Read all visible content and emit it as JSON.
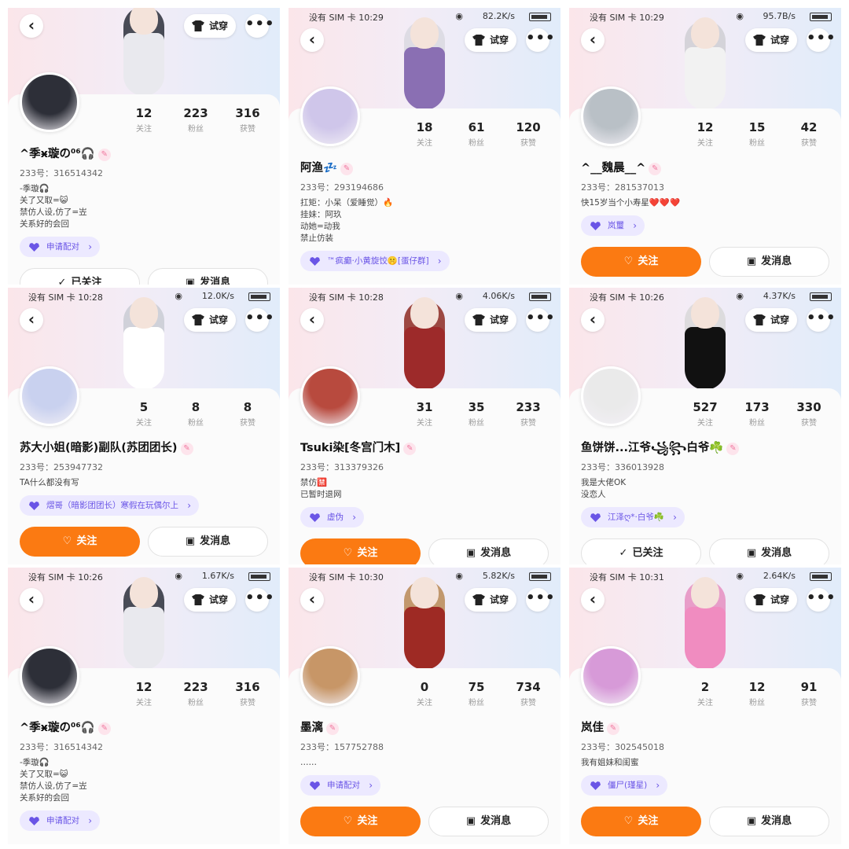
{
  "stat_labels": {
    "following": "关注",
    "fans": "粉丝",
    "likes": "获赞"
  },
  "buttons": {
    "try_on": "试穿",
    "follow": "关注",
    "followed": "已关注",
    "message": "发消息",
    "more": "•••",
    "back": "‹"
  },
  "icons": {
    "back": "chevron-left-icon",
    "try_on": "tshirt-icon",
    "more": "more-dots-icon",
    "tag": "heart-icon",
    "follow": "heart-plus-icon",
    "message": "chat-bubble-icon",
    "pin": "pin-badge-icon"
  },
  "colors": {
    "accent_orange": "#fb7a12",
    "tag_purple": "#6a55e6",
    "tag_bg": "#ece9ff"
  },
  "profiles": [
    {
      "status": {
        "time": "",
        "speed": "",
        "carrier": ""
      },
      "following": "12",
      "fans": "223",
      "likes": "316",
      "name": "^季ӿ璇の⁰⁶🎧",
      "uid": "233号：316514342",
      "bio": [
        "-季璇🎧",
        "关了又取=😺",
        "禁仿人设,仿了=岦",
        "关系好的会回"
      ],
      "tag": "申请配对",
      "follow_state": "followed"
    },
    {
      "status": {
        "time": "没有 SIM 卡 10:29",
        "speed": "82.2K/s"
      },
      "following": "18",
      "fans": "61",
      "likes": "120",
      "name": "阿渔💤",
      "uid": "233号：293194686",
      "bio": [
        "扛矩：小呆（爱睡觉）🔥",
        "挂妹：阿玖",
        "动她=动我",
        "禁止仿装"
      ],
      "tag": "™疯癫·小黄旋饺🤫[蛋仔群]",
      "follow_state": "none"
    },
    {
      "status": {
        "time": "没有 SIM 卡 10:29",
        "speed": "95.7B/s"
      },
      "following": "12",
      "fans": "15",
      "likes": "42",
      "name": "^__魏晨__^",
      "uid": "233号：281537013",
      "bio": [
        "快15岁当个小寿星❤️❤️❤️"
      ],
      "tag": "岚璽",
      "follow_state": "follow"
    },
    {
      "status": {
        "time": "没有 SIM 卡 10:28",
        "speed": "12.0K/s"
      },
      "following": "5",
      "fans": "8",
      "likes": "8",
      "name": "苏大小姐(暗影)副队(苏团团长)",
      "uid": "233号：253947732",
      "bio": [
        "TA什么都没有写"
      ],
      "tag": "熠哥（暗影团团长）寒假在玩偶尔上",
      "follow_state": "follow"
    },
    {
      "status": {
        "time": "没有 SIM 卡 10:28",
        "speed": "4.06K/s"
      },
      "following": "31",
      "fans": "35",
      "likes": "233",
      "name": "Tsuki染[冬宫门木]",
      "uid": "233号：313379326",
      "bio": [
        "禁仿🈲",
        "已暂时退网"
      ],
      "tag": "虚伪",
      "follow_state": "follow"
    },
    {
      "status": {
        "time": "没有 SIM 卡 10:26",
        "speed": "4.37K/s"
      },
      "following": "527",
      "fans": "173",
      "likes": "330",
      "name": "鱼饼饼...江爷꧁꧂白爷☘️",
      "uid": "233号：336013928",
      "bio": [
        "我是大佬OK",
        "没恋人"
      ],
      "tag": "江泽ღ*·白爷☘️",
      "follow_state": "followed"
    },
    {
      "status": {
        "time": "没有 SIM 卡 10:26",
        "speed": "1.67K/s"
      },
      "following": "12",
      "fans": "223",
      "likes": "316",
      "name": "^季ӿ璇の⁰⁶🎧",
      "uid": "233号：316514342",
      "bio": [
        "-季璇🎧",
        "关了又取=😺",
        "禁仿人设,仿了=岦",
        "关系好的会回"
      ],
      "tag": "申请配对",
      "follow_state": "none"
    },
    {
      "status": {
        "time": "没有 SIM 卡 10:30",
        "speed": "5.82K/s"
      },
      "following": "0",
      "fans": "75",
      "likes": "734",
      "name": "墨漓",
      "uid": "233号：157752788",
      "bio": [
        "……"
      ],
      "tag": "申请配对",
      "follow_state": "follow"
    },
    {
      "status": {
        "time": "没有 SIM 卡 10:31",
        "speed": "2.64K/s"
      },
      "following": "2",
      "fans": "12",
      "likes": "91",
      "name": "岚佳",
      "uid": "233号：302545018",
      "bio": [
        "我有姐妹和闺蜜"
      ],
      "tag": "僵尸(瑾星)",
      "follow_state": "follow"
    }
  ]
}
